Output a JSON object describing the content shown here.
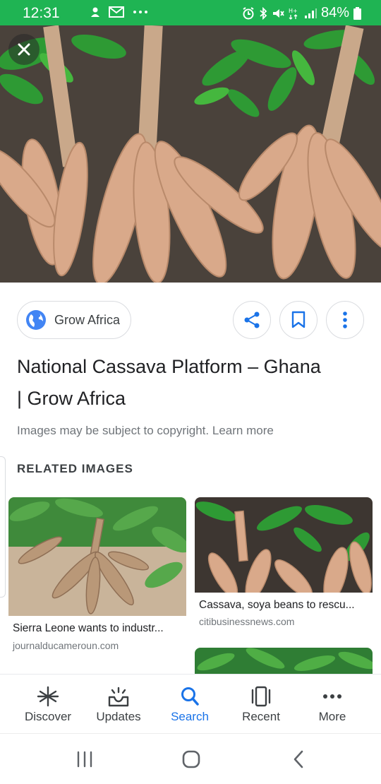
{
  "status_bar": {
    "time": "12:31",
    "battery": "84%",
    "color": "#1fb453"
  },
  "viewer": {
    "close_icon": "close-icon",
    "source": {
      "name": "Grow Africa",
      "icon": "globe-icon"
    },
    "actions": [
      {
        "icon": "share-icon"
      },
      {
        "icon": "bookmark-icon"
      },
      {
        "icon": "more-vert-icon"
      }
    ],
    "title_line1": "National Cassava Platform – Ghana",
    "title_line2": "| Grow Africa",
    "copyright_text": "Images may be subject to copyright.",
    "learn_more": "Learn more"
  },
  "related": {
    "heading": "RELATED IMAGES",
    "items": [
      {
        "caption": "Sierra Leone wants to industr...",
        "domain": "journalducameroun.com"
      },
      {
        "caption": "Cassava, soya beans to rescu...",
        "domain": "citibusinessnews.com"
      }
    ]
  },
  "bottom_nav": {
    "accent": "#1a73e8",
    "items": [
      {
        "label": "Discover",
        "icon": "asterisk-icon",
        "active": false
      },
      {
        "label": "Updates",
        "icon": "updates-tray-icon",
        "active": false
      },
      {
        "label": "Search",
        "icon": "search-icon",
        "active": true
      },
      {
        "label": "Recent",
        "icon": "recent-cards-icon",
        "active": false
      },
      {
        "label": "More",
        "icon": "more-horiz-icon",
        "active": false
      }
    ]
  },
  "system_nav": {
    "buttons": [
      "recents-icon",
      "home-icon",
      "back-icon"
    ]
  }
}
